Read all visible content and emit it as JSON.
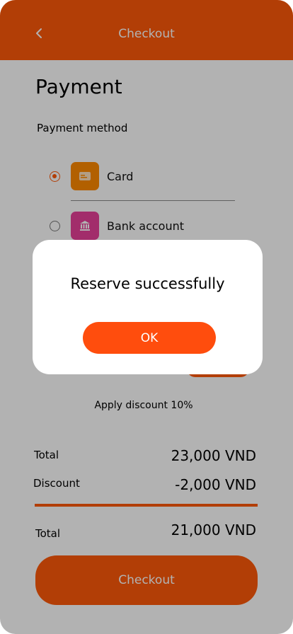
{
  "header": {
    "title": "Checkout",
    "back_icon": "chevron-left-icon"
  },
  "page": {
    "title": "Payment",
    "section_label": "Payment method"
  },
  "payment_methods": [
    {
      "label": "Card",
      "icon": "credit-card-icon",
      "icon_color": "#ff8a00",
      "selected": true
    },
    {
      "label": "Bank account",
      "icon": "bank-icon",
      "icon_color": "#e8419a",
      "selected": false
    }
  ],
  "discount_note": "Apply discount 10%",
  "summary": {
    "total_label": "Total",
    "total_value": "23,000 VND",
    "discount_label": "Discount",
    "discount_value": "-2,000 VND",
    "final_label": "Total",
    "final_value": "21,000 VND"
  },
  "checkout_button": "Checkout",
  "modal": {
    "message": "Reserve successfully",
    "ok_label": "OK"
  },
  "colors": {
    "accent": "#ff5a0a",
    "modal_button": "#ff4d0d"
  }
}
